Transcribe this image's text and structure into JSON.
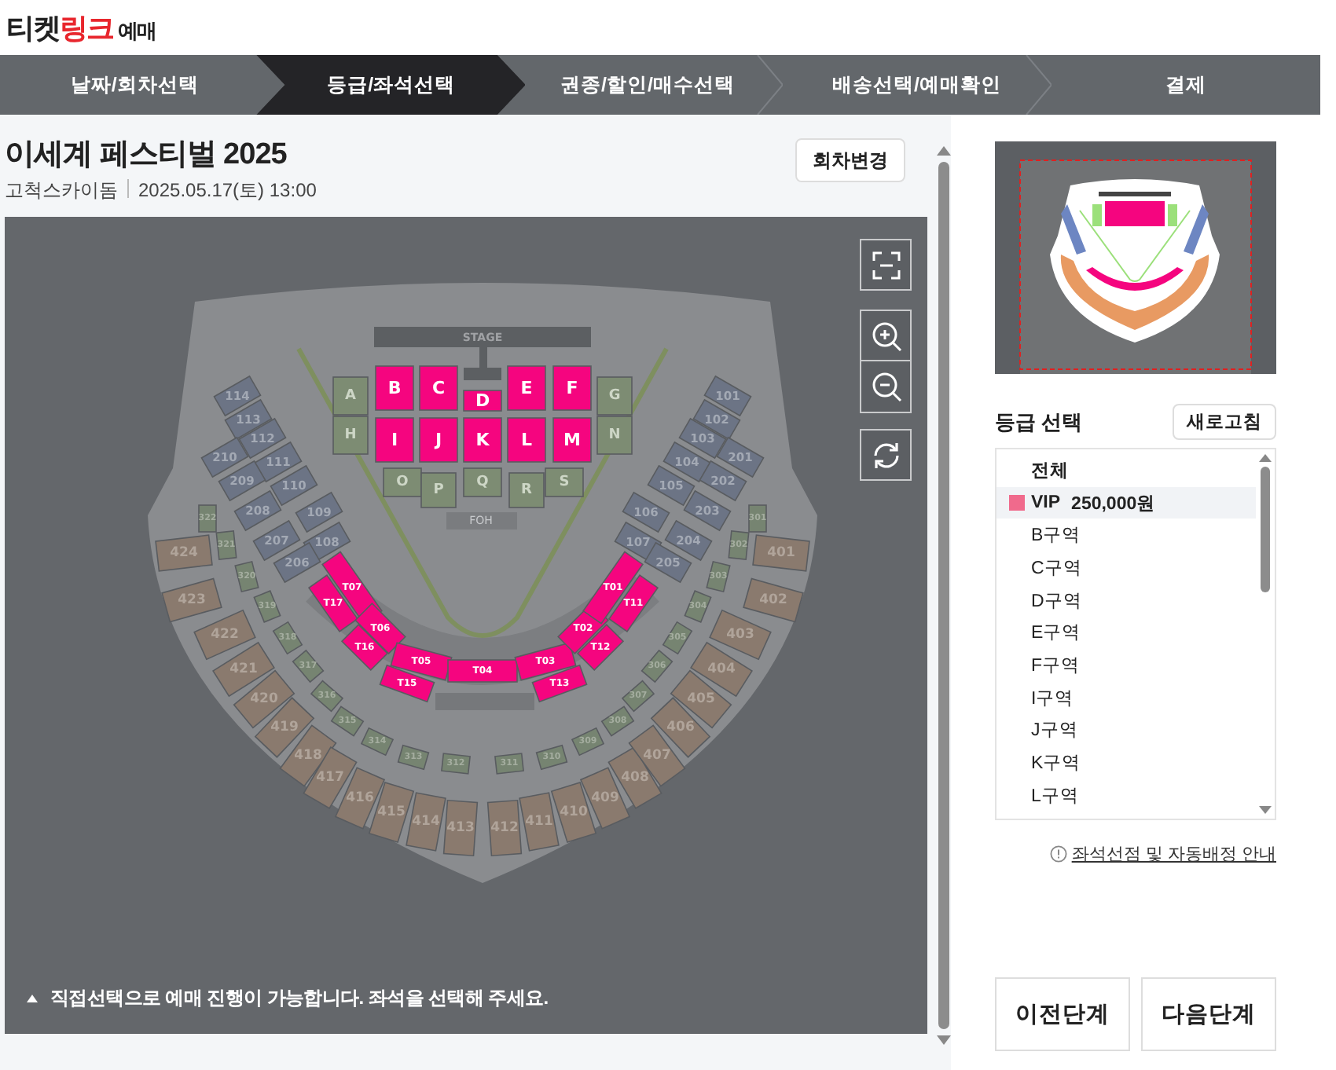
{
  "logo": [
    {
      "text": "티켓",
      "kind": "plain"
    },
    {
      "text": "링크",
      "kind": "accent"
    },
    {
      "text": "예매",
      "kind": "suffix"
    }
  ],
  "steps": [
    {
      "label": "날짜/회차선택",
      "selected": false
    },
    {
      "label": "등급/좌석선택",
      "selected": true
    },
    {
      "label": "권종/할인/매수선택",
      "selected": false
    },
    {
      "label": "배송선택/예매확인",
      "selected": false
    },
    {
      "label": "결제",
      "selected": false
    }
  ],
  "event": {
    "title": "이세계 페스티벌 2025",
    "venue": "고척스카이돔",
    "datetime": "2025.05.17(토) 13:00",
    "change_button": "회차변경"
  },
  "seat_map": {
    "stage": "STAGE",
    "foh": "FOH",
    "floor_sections": [
      {
        "label": "A",
        "kind": "floor"
      },
      {
        "label": "B",
        "kind": "vip"
      },
      {
        "label": "C",
        "kind": "vip"
      },
      {
        "label": "D",
        "kind": "vip"
      },
      {
        "label": "E",
        "kind": "vip"
      },
      {
        "label": "F",
        "kind": "vip"
      },
      {
        "label": "G",
        "kind": "floor"
      },
      {
        "label": "H",
        "kind": "floor"
      },
      {
        "label": "I",
        "kind": "vip"
      },
      {
        "label": "J",
        "kind": "vip"
      },
      {
        "label": "K",
        "kind": "vip"
      },
      {
        "label": "L",
        "kind": "vip"
      },
      {
        "label": "M",
        "kind": "vip"
      },
      {
        "label": "N",
        "kind": "floor"
      },
      {
        "label": "O",
        "kind": "floor"
      },
      {
        "label": "P",
        "kind": "floor"
      },
      {
        "label": "Q",
        "kind": "floor"
      },
      {
        "label": "R",
        "kind": "floor"
      },
      {
        "label": "S",
        "kind": "floor"
      }
    ],
    "table_sections": [
      {
        "label": "T07",
        "kind": "vip"
      },
      {
        "label": "T17",
        "kind": "vip"
      },
      {
        "label": "T06",
        "kind": "vip"
      },
      {
        "label": "T16",
        "kind": "vip"
      },
      {
        "label": "T05",
        "kind": "vip"
      },
      {
        "label": "T15",
        "kind": "vip"
      },
      {
        "label": "T04",
        "kind": "vip"
      },
      {
        "label": "T03",
        "kind": "vip"
      },
      {
        "label": "T13",
        "kind": "vip"
      },
      {
        "label": "T02",
        "kind": "vip"
      },
      {
        "label": "T12",
        "kind": "vip"
      },
      {
        "label": "T01",
        "kind": "vip"
      },
      {
        "label": "T11",
        "kind": "vip"
      }
    ],
    "upper_sections": [
      {
        "label": "114",
        "kind": "upper"
      },
      {
        "label": "113",
        "kind": "upper"
      },
      {
        "label": "112",
        "kind": "upper"
      },
      {
        "label": "111",
        "kind": "upper"
      },
      {
        "label": "110",
        "kind": "upper"
      },
      {
        "label": "109",
        "kind": "upper"
      },
      {
        "label": "108",
        "kind": "upper"
      },
      {
        "label": "210",
        "kind": "upper"
      },
      {
        "label": "209",
        "kind": "upper"
      },
      {
        "label": "208",
        "kind": "upper"
      },
      {
        "label": "207",
        "kind": "upper"
      },
      {
        "label": "206",
        "kind": "upper"
      },
      {
        "label": "101",
        "kind": "upper"
      },
      {
        "label": "102",
        "kind": "upper"
      },
      {
        "label": "103",
        "kind": "upper"
      },
      {
        "label": "104",
        "kind": "upper"
      },
      {
        "label": "105",
        "kind": "upper"
      },
      {
        "label": "106",
        "kind": "upper"
      },
      {
        "label": "107",
        "kind": "upper"
      },
      {
        "label": "201",
        "kind": "upper"
      },
      {
        "label": "202",
        "kind": "upper"
      },
      {
        "label": "203",
        "kind": "upper"
      },
      {
        "label": "204",
        "kind": "upper"
      },
      {
        "label": "205",
        "kind": "upper"
      }
    ],
    "ring_sections": [
      {
        "label": "322",
        "kind": "ring"
      },
      {
        "label": "321",
        "kind": "ring"
      },
      {
        "label": "320",
        "kind": "ring"
      },
      {
        "label": "319",
        "kind": "ring"
      },
      {
        "label": "318",
        "kind": "ring"
      },
      {
        "label": "317",
        "kind": "ring"
      },
      {
        "label": "316",
        "kind": "ring"
      },
      {
        "label": "315",
        "kind": "ring"
      },
      {
        "label": "314",
        "kind": "ring"
      },
      {
        "label": "313",
        "kind": "ring"
      },
      {
        "label": "312",
        "kind": "ring"
      },
      {
        "label": "311",
        "kind": "ring"
      },
      {
        "label": "310",
        "kind": "ring"
      },
      {
        "label": "309",
        "kind": "ring"
      },
      {
        "label": "308",
        "kind": "ring"
      },
      {
        "label": "307",
        "kind": "ring"
      },
      {
        "label": "306",
        "kind": "ring"
      },
      {
        "label": "305",
        "kind": "ring"
      },
      {
        "label": "304",
        "kind": "ring"
      },
      {
        "label": "303",
        "kind": "ring"
      },
      {
        "label": "302",
        "kind": "ring"
      },
      {
        "label": "301",
        "kind": "ring"
      }
    ],
    "lower_sections": [
      {
        "label": "424",
        "kind": "lower"
      },
      {
        "label": "423",
        "kind": "lower"
      },
      {
        "label": "422",
        "kind": "lower"
      },
      {
        "label": "421",
        "kind": "lower"
      },
      {
        "label": "420",
        "kind": "lower"
      },
      {
        "label": "419",
        "kind": "lower"
      },
      {
        "label": "418",
        "kind": "lower"
      },
      {
        "label": "417",
        "kind": "lower"
      },
      {
        "label": "416",
        "kind": "lower"
      },
      {
        "label": "415",
        "kind": "lower"
      },
      {
        "label": "414",
        "kind": "lower"
      },
      {
        "label": "413",
        "kind": "lower"
      },
      {
        "label": "412",
        "kind": "lower"
      },
      {
        "label": "411",
        "kind": "lower"
      },
      {
        "label": "410",
        "kind": "lower"
      },
      {
        "label": "409",
        "kind": "lower"
      },
      {
        "label": "408",
        "kind": "lower"
      },
      {
        "label": "407",
        "kind": "lower"
      },
      {
        "label": "406",
        "kind": "lower"
      },
      {
        "label": "405",
        "kind": "lower"
      },
      {
        "label": "404",
        "kind": "lower"
      },
      {
        "label": "403",
        "kind": "lower"
      },
      {
        "label": "402",
        "kind": "lower"
      },
      {
        "label": "401",
        "kind": "lower"
      }
    ],
    "notice": "직접선택으로 예매 진행이 가능합니다. 좌석을 선택해 주세요."
  },
  "grade_panel": {
    "title": "등급 선택",
    "refresh_button": "새로고침",
    "items": [
      {
        "label": "전체",
        "kind": "all",
        "selected": false
      },
      {
        "label": "VIP",
        "price": "250,000원",
        "kind": "grade",
        "color": "#f06a8c",
        "selected": true
      },
      {
        "label": "B구역",
        "kind": "zone",
        "selected": false
      },
      {
        "label": "C구역",
        "kind": "zone",
        "selected": false
      },
      {
        "label": "D구역",
        "kind": "zone",
        "selected": false
      },
      {
        "label": "E구역",
        "kind": "zone",
        "selected": false
      },
      {
        "label": "F구역",
        "kind": "zone",
        "selected": false
      },
      {
        "label": "I구역",
        "kind": "zone",
        "selected": false
      },
      {
        "label": "J구역",
        "kind": "zone",
        "selected": false
      },
      {
        "label": "K구역",
        "kind": "zone",
        "selected": false
      },
      {
        "label": "L구역",
        "kind": "zone",
        "selected": false
      }
    ]
  },
  "info_link": "좌석선점 및 자동배정 안내",
  "buttons": [
    {
      "label": "이전단계"
    },
    {
      "label": "다음단계"
    }
  ]
}
